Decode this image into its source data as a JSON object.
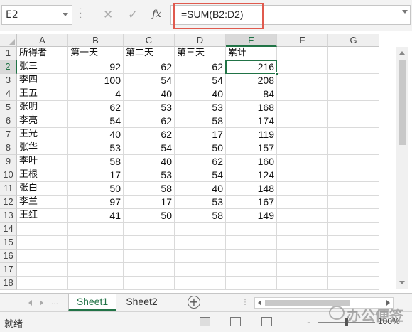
{
  "formula_bar": {
    "name_box": "E2",
    "fx_label": "fx",
    "formula": "=SUM(B2:D2)",
    "cancel_glyph": "✕",
    "enter_glyph": "✓"
  },
  "grid": {
    "columns": [
      "A",
      "B",
      "C",
      "D",
      "E",
      "F",
      "G"
    ],
    "row_numbers": [
      "1",
      "2",
      "3",
      "4",
      "5",
      "6",
      "7",
      "8",
      "9",
      "10",
      "11",
      "12",
      "13",
      "14",
      "15",
      "16",
      "17",
      "18"
    ],
    "header_row": [
      "所得者",
      "第一天",
      "第二天",
      "第三天",
      "累计"
    ],
    "rows": [
      [
        "张三",
        "92",
        "62",
        "62",
        "216"
      ],
      [
        "李四",
        "100",
        "54",
        "54",
        "208"
      ],
      [
        "王五",
        "4",
        "40",
        "40",
        "84"
      ],
      [
        "张明",
        "62",
        "53",
        "53",
        "168"
      ],
      [
        "李亮",
        "54",
        "62",
        "58",
        "174"
      ],
      [
        "王光",
        "40",
        "62",
        "17",
        "119"
      ],
      [
        "张华",
        "53",
        "54",
        "50",
        "157"
      ],
      [
        "李叶",
        "58",
        "40",
        "62",
        "160"
      ],
      [
        "王根",
        "17",
        "53",
        "54",
        "124"
      ],
      [
        "张白",
        "50",
        "58",
        "40",
        "148"
      ],
      [
        "李兰",
        "97",
        "17",
        "53",
        "167"
      ],
      [
        "王红",
        "41",
        "50",
        "58",
        "149"
      ]
    ],
    "active_cell": "E2"
  },
  "tabs": {
    "sheets": [
      "Sheet1",
      "Sheet2"
    ],
    "active": "Sheet1",
    "add_glyph": "+"
  },
  "status": {
    "text": "就绪",
    "zoom_minus": "-",
    "zoom": "100%"
  },
  "watermark": {
    "text": "办公便签"
  },
  "colors": {
    "accent": "#217346",
    "highlight_box": "#e05a4e"
  }
}
